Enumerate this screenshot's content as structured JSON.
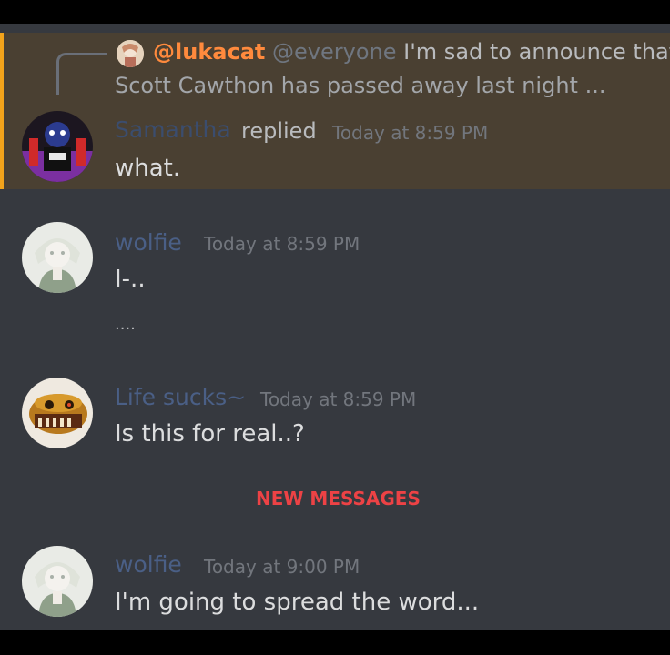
{
  "reply_preview": {
    "author": "@lukacat",
    "mention": "@everyone",
    "text_line1": "I'm sad to announce that",
    "text_line2": "Scott Cawthon has passed away last night ..."
  },
  "messages": [
    {
      "username": "Samantha",
      "replied_label": "replied",
      "timestamp": "Today at 8:59 PM",
      "lines": [
        "what."
      ],
      "username_color": "#3b4d6e",
      "highlighted": true
    },
    {
      "username": "wolfie",
      "timestamp": "Today at 8:59 PM",
      "lines": [
        "I-..",
        "...."
      ],
      "username_color": "#4a5f86"
    },
    {
      "username": "Life sucks~",
      "timestamp": "Today at 8:59 PM",
      "lines": [
        "Is this for real..?"
      ],
      "username_color": "#4a5f86"
    },
    {
      "username": "wolfie",
      "timestamp": "Today at 9:00 PM",
      "lines": [
        "I'm going to spread the word..."
      ],
      "username_color": "#4a5f86"
    }
  ],
  "divider": {
    "label": "NEW MESSAGES",
    "color": "#ed4245"
  },
  "colors": {
    "chat_background": "#36393f",
    "highlight_background": "#4a4032",
    "highlight_accent": "#f2a31b",
    "mention_author": "#ff8a3d"
  }
}
